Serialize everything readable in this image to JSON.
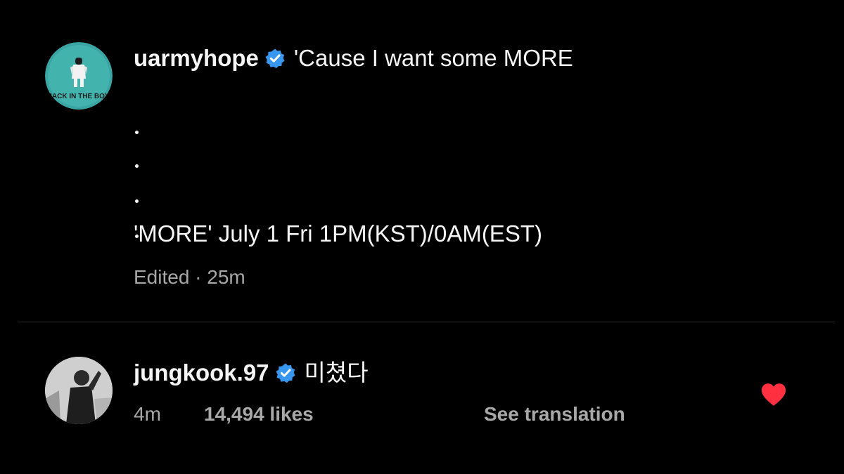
{
  "caption": {
    "username": "uarmyhope",
    "text": "'Cause I want some MORE",
    "dots": [
      ".",
      ".",
      ".",
      "."
    ],
    "release_line": "'MORE' July 1 Fri 1PM(KST)/0AM(EST)",
    "meta": "Edited · 25m",
    "avatar_text": "JACK IN THE BOX"
  },
  "comment": {
    "username": "jungkook.97",
    "text": "미쳤다",
    "time": "4m",
    "likes": "14,494 likes",
    "see_translation": "See translation",
    "liked": true
  },
  "colors": {
    "background": "#000000",
    "text": "#f5f5f5",
    "secondary_text": "#a8a8a8",
    "verified_blue": "#3897f0",
    "heart_red": "#ff3040",
    "avatar1_bg": "#3aa6a3"
  },
  "icons": {
    "verified": "verified-badge-icon",
    "heart": "heart-filled-icon"
  }
}
